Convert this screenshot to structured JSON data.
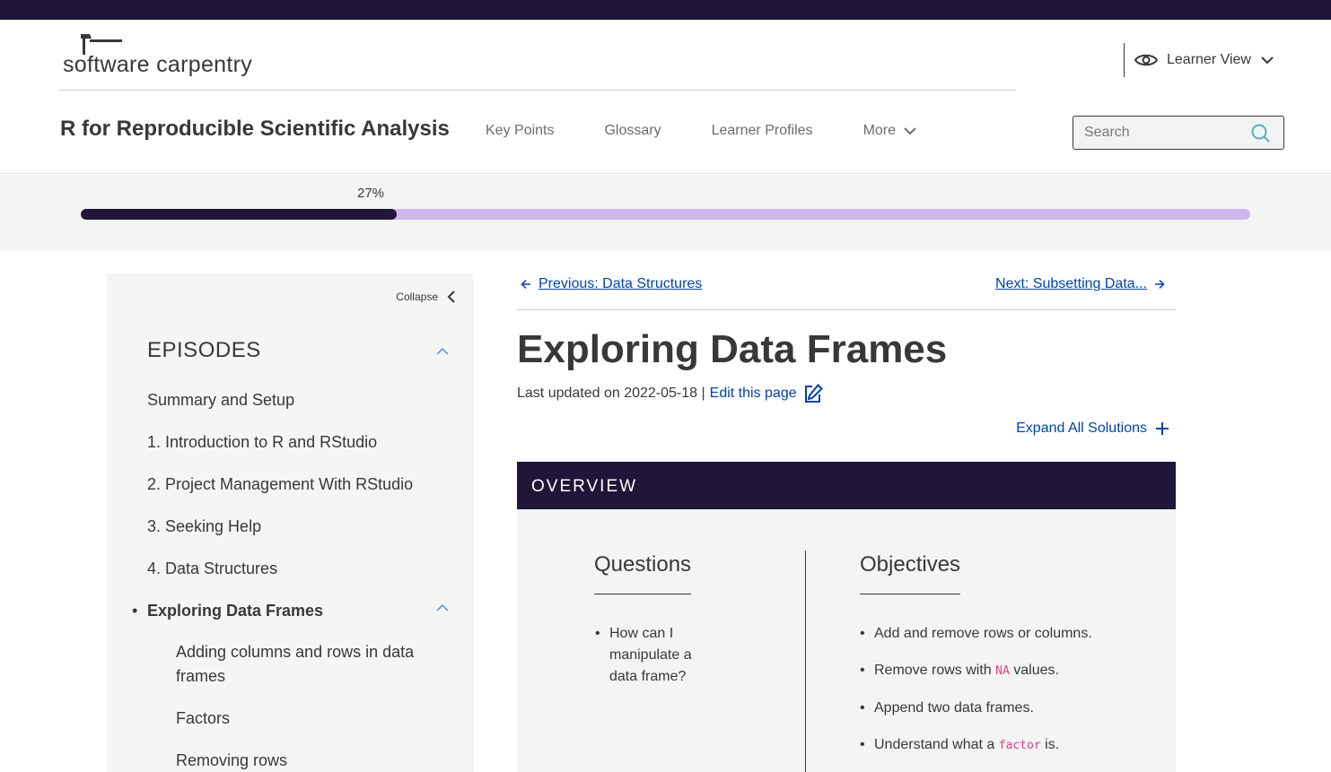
{
  "header": {
    "logo_text": "software carpentry",
    "view_toggle_label": "Learner View",
    "site_title": "R for Reproducible Scientific Analysis",
    "nav": [
      "Key Points",
      "Glossary",
      "Learner Profiles",
      "More"
    ],
    "search_placeholder": "Search"
  },
  "progress": {
    "label": "27%",
    "fraction": 0.27
  },
  "sidebar": {
    "collapse_label": "Collapse",
    "episodes_header": "EPISODES",
    "episodes": [
      "Summary and Setup",
      "1. Introduction to R and RStudio",
      "2. Project Management With RStudio",
      "3. Seeking Help",
      "4. Data Structures"
    ],
    "active_episode": "Exploring Data Frames",
    "active_bullet": "•",
    "sub_items": [
      "Adding columns and rows in data frames",
      "Factors",
      "Removing rows"
    ]
  },
  "main": {
    "prev_label": "Previous: Data Structures",
    "next_label": "Next: Subsetting Data...",
    "title": "Exploring Data Frames",
    "updated_prefix": "Last updated on 2022-05-18 |",
    "edit_label": "Edit this page",
    "expand_label": "Expand All Solutions",
    "overview": {
      "header": "OVERVIEW",
      "questions_title": "Questions",
      "questions": [
        "How can I manipulate a data frame?"
      ],
      "objectives_title": "Objectives",
      "objectives": [
        {
          "before": "Add and remove rows or columns.",
          "code": "",
          "after": ""
        },
        {
          "before": "Remove rows with ",
          "code": "NA",
          "after": " values."
        },
        {
          "before": "Append two data frames.",
          "code": "",
          "after": ""
        },
        {
          "before": "Understand what a ",
          "code": "factor",
          "after": " is."
        }
      ]
    }
  },
  "colors": {
    "brand_dark": "#201639",
    "progress_track": "#d0b6ee",
    "link": "#0044aa",
    "code": "#e83e8c"
  },
  "icons": [
    "eye-icon",
    "chevron-down-icon",
    "search-icon",
    "chevron-left-icon",
    "chevron-up-icon",
    "arrow-left-icon",
    "arrow-right-icon",
    "edit-icon",
    "plus-icon"
  ]
}
